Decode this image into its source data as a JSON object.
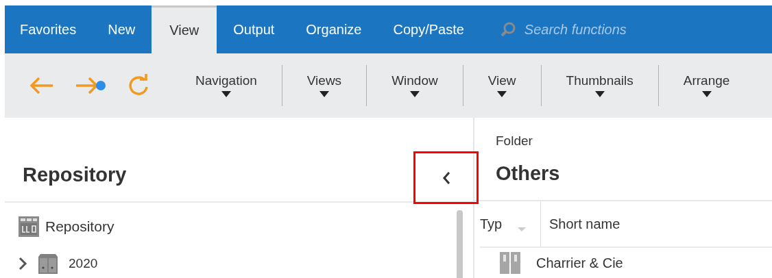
{
  "ribbon_tabs": [
    {
      "label": "Favorites",
      "selected": false
    },
    {
      "label": "New",
      "selected": false
    },
    {
      "label": "View",
      "selected": true
    },
    {
      "label": "Output",
      "selected": false
    },
    {
      "label": "Organize",
      "selected": false
    },
    {
      "label": "Copy/Paste",
      "selected": false
    }
  ],
  "search": {
    "placeholder": "Search functions"
  },
  "toolbar": {
    "nav_buttons": [
      {
        "kind": "back"
      },
      {
        "kind": "forward"
      },
      {
        "kind": "refresh"
      }
    ],
    "groups": [
      {
        "label": "Navigation"
      },
      {
        "label": "Views"
      },
      {
        "label": "Window"
      },
      {
        "label": "View"
      },
      {
        "label": "Thumbnails"
      },
      {
        "label": "Arrange"
      }
    ]
  },
  "left_panel": {
    "title": "Repository",
    "collapse_button": {
      "highlighted": true
    },
    "tree": [
      {
        "label": "Repository",
        "kind": "repository",
        "children": [
          {
            "label": "2020",
            "kind": "cabinet",
            "expanded": false
          }
        ]
      }
    ]
  },
  "right_panel": {
    "subtitle": "Folder",
    "title": "Others",
    "table": {
      "columns": [
        "Typ",
        "Short name"
      ],
      "rows": [
        {
          "kind": "binder",
          "short_name": "Charrier & Cie"
        }
      ]
    }
  }
}
